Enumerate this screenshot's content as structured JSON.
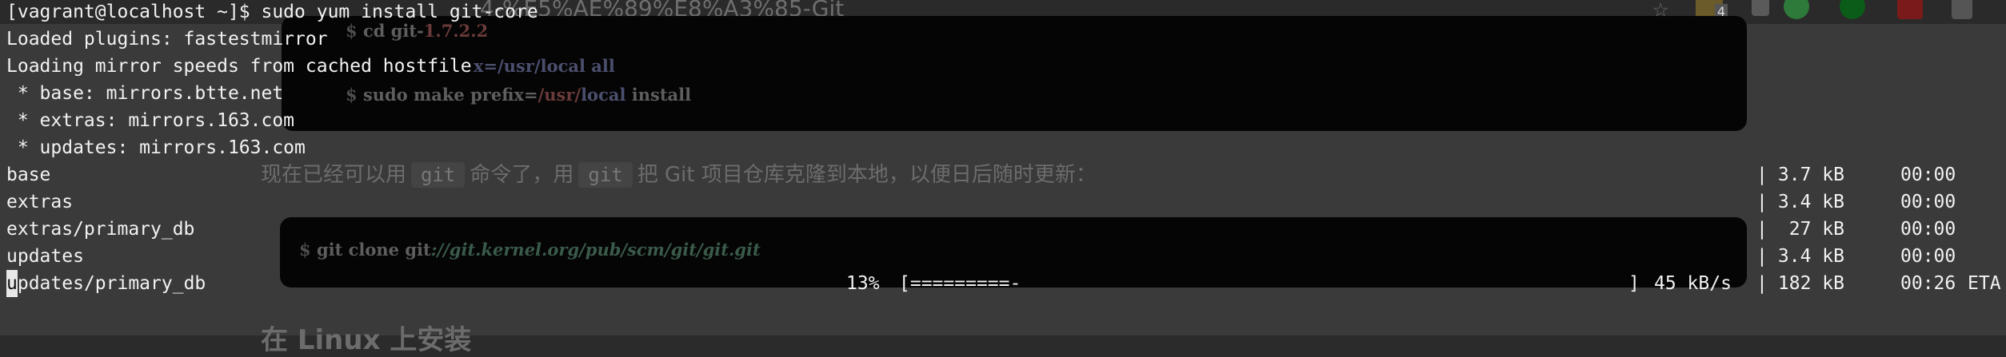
{
  "background_page": {
    "url_fragment": "4-%E5%AE%89%E8%A3%85-Git",
    "toolbar_badge": "4",
    "code_block_1": {
      "line1_prompt": "$ ",
      "line1_cmd": "cd git-",
      "line1_ver": "1.7.2.2",
      "line2_tail": "x=/usr/local all",
      "line3_prompt": "$ ",
      "line3_cmd": "sudo make prefix=",
      "line3_path1": "/usr/",
      "line3_path2": "local",
      "line3_end": " install"
    },
    "prose": {
      "part1": "现在已经可以用",
      "chip1": "git",
      "part2": "命令了，用",
      "chip2": "git",
      "part3": "把 Git 项目仓库克隆到本地，以便日后随时更新："
    },
    "code_block_2": {
      "prompt": "$ ",
      "cmd": "git clone git",
      "url": "://git.kernel.org/pub/scm/git/git.git"
    },
    "heading_partial": "在 Linux 上安装"
  },
  "terminal": {
    "prompt_line": "[vagrant@localhost ~]$ sudo yum install git-core",
    "lines": [
      "Loaded plugins: fastestmirror",
      "Loading mirror speeds from cached hostfile",
      " * base: mirrors.btte.net",
      " * extras: mirrors.163.com",
      " * updates: mirrors.163.com"
    ],
    "repos": [
      {
        "name": "base",
        "sep": "|",
        "size": "3.7 kB",
        "time": "00:00"
      },
      {
        "name": "extras",
        "sep": "|",
        "size": "3.4 kB",
        "time": "00:00"
      },
      {
        "name": "extras/primary_db",
        "sep": "|",
        "size": "27 kB",
        "time": "00:00"
      },
      {
        "name": "updates",
        "sep": "|",
        "size": "3.4 kB",
        "time": "00:00"
      }
    ],
    "current_download": {
      "cursor_char": "u",
      "name_rest": "pdates/primary_db",
      "percent": "13%",
      "progress_bar": "[=========-",
      "bar_end": "]",
      "speed": "45 kB/s",
      "sep": "|",
      "size": "182 kB",
      "time": "00:26",
      "eta": "ETA"
    }
  }
}
